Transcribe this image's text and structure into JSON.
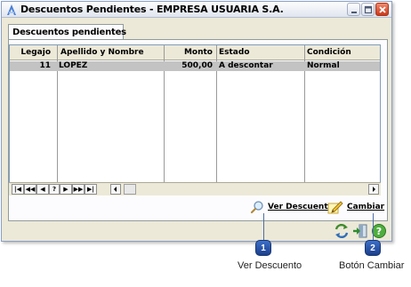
{
  "window": {
    "title": "Descuentos Pendientes - EMPRESA USUARIA S.A."
  },
  "tab": {
    "label": "Descuentos pendientes"
  },
  "table": {
    "columns": [
      "Legajo",
      "Apellido y Nombre",
      "Monto",
      "Estado",
      "Condición"
    ],
    "rows": [
      [
        "11",
        "LOPEZ",
        "500,00",
        "A descontar",
        "Normal"
      ]
    ]
  },
  "navigator": {
    "buttons": [
      "|◀",
      "◀◀",
      "◀",
      "?",
      "▶",
      "▶▶",
      "▶|"
    ]
  },
  "actions": {
    "ver_descuento": "Ver Descuento",
    "cambiar": "Cambiar"
  },
  "callouts": [
    {
      "number": "1",
      "label": "Ver Descuento"
    },
    {
      "number": "2",
      "label": "Botón Cambiar"
    }
  ],
  "icons": {
    "app": "app-a-icon",
    "ver_descuento": "magnifier-icon",
    "cambiar": "pencil-icon",
    "refresh": "refresh-arrows-icon",
    "exit": "door-exit-icon",
    "help": "help-icon"
  },
  "colors": {
    "selected_row": "#c3c3c3",
    "callout_badge": "#2a56ad",
    "window_face": "#ece9d8"
  }
}
